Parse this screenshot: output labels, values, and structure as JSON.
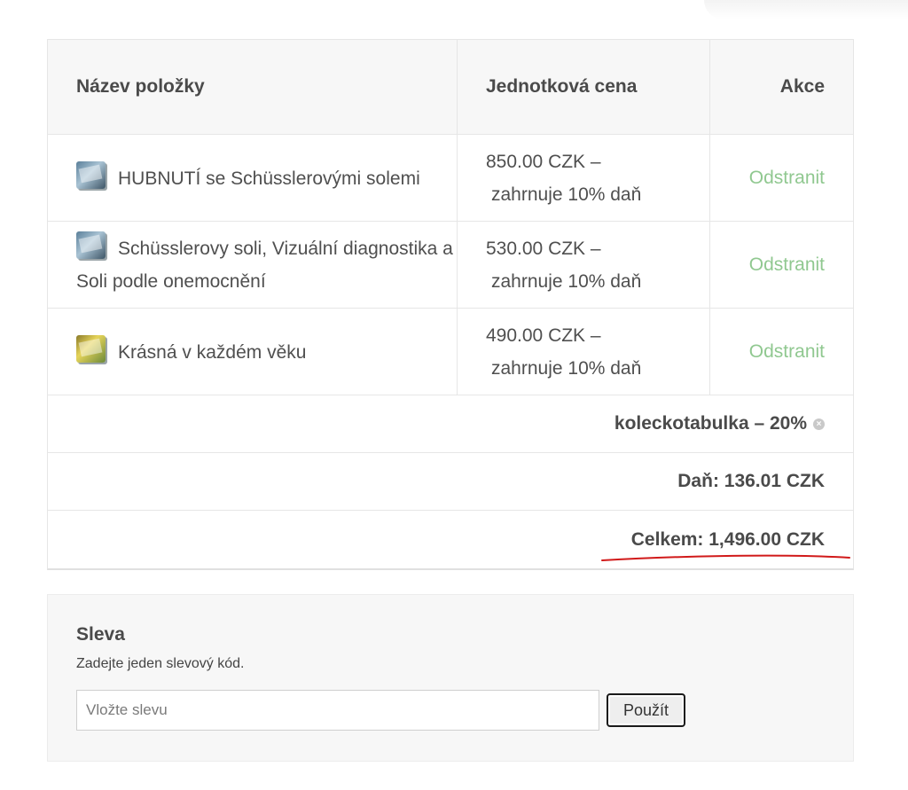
{
  "cart": {
    "headers": {
      "item_name": "Název položky",
      "unit_price": "Jednotková cena",
      "action": "Akce"
    },
    "items": [
      {
        "title": "HUBNUTÍ se Schüsslerovými solemi",
        "thumb_icon": "book-cover-thumbnail",
        "price_line1": "850.00 CZK –",
        "price_line2": "zahrnuje 10% daň",
        "action_label": "Odstranit"
      },
      {
        "title": "Schüsslerovy soli, Vizuální diagnostika a Soli podle onemocnění",
        "thumb_icon": "book-cover-thumbnail",
        "price_line1": "530.00 CZK –",
        "price_line2": "zahrnuje 10% daň",
        "action_label": "Odstranit"
      },
      {
        "title": "Krásná v každém věku",
        "thumb_icon": "book-cover-thumbnail",
        "price_line1": "490.00 CZK –",
        "price_line2": "zahrnuje 10% daň",
        "action_label": "Odstranit"
      }
    ],
    "coupon_line": "koleckotabulka – 20%",
    "tax_line": "Daň: 136.01 CZK",
    "total_line": "Celkem: 1,496.00 CZK"
  },
  "discount": {
    "title": "Sleva",
    "description": "Zadejte jeden slevový kód.",
    "input_placeholder": "Vložte slevu",
    "input_value": "",
    "apply_label": "Použít"
  },
  "colors": {
    "remove_link": "#90c890",
    "annotation_underline": "#d11a1a",
    "header_background": "#f7f7f7"
  }
}
